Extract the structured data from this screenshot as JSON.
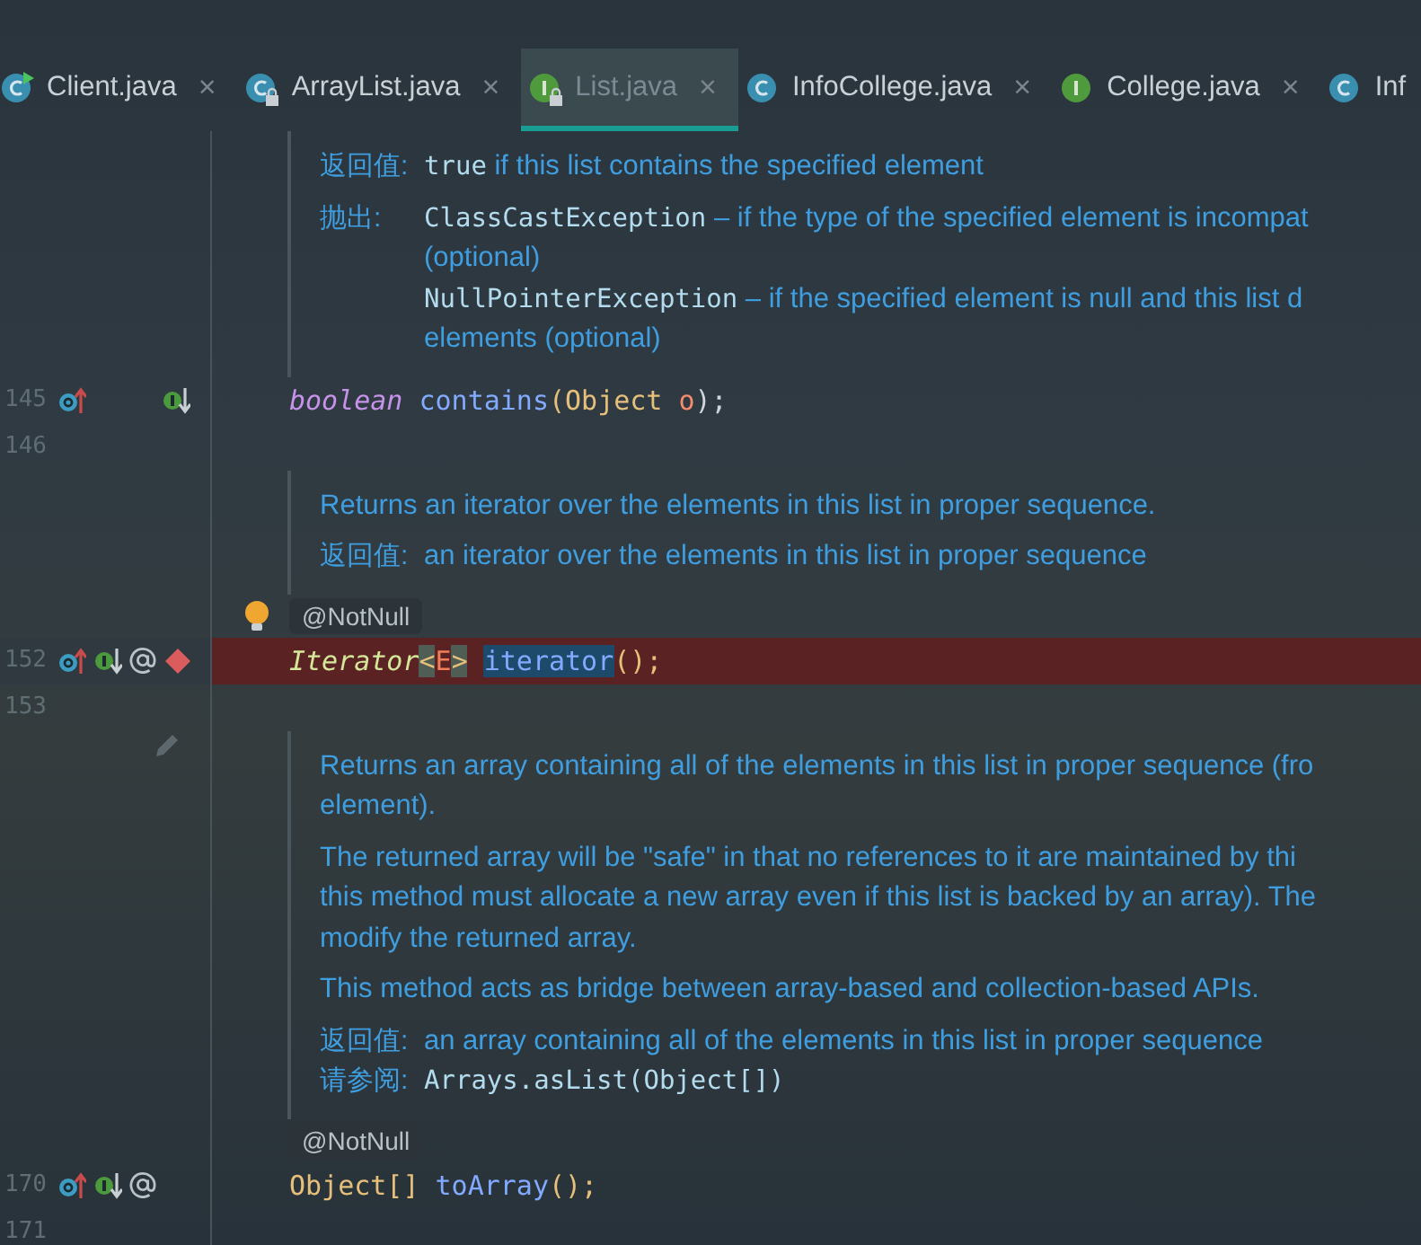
{
  "tabs": [
    {
      "label": "Client.java",
      "kind": "class",
      "runnable": true,
      "locked": false,
      "selected": false,
      "closable": true
    },
    {
      "label": "ArrayList.java",
      "kind": "class",
      "runnable": false,
      "locked": true,
      "selected": false,
      "closable": true
    },
    {
      "label": "List.java",
      "kind": "interface",
      "runnable": false,
      "locked": true,
      "selected": true,
      "closable": true
    },
    {
      "label": "InfoCollege.java",
      "kind": "class",
      "runnable": false,
      "locked": false,
      "selected": false,
      "closable": true
    },
    {
      "label": "College.java",
      "kind": "interface",
      "runnable": false,
      "locked": false,
      "selected": false,
      "closable": true
    },
    {
      "label": "Inf",
      "kind": "class",
      "runnable": false,
      "locked": false,
      "selected": false,
      "closable": false
    }
  ],
  "close_glyph": "×",
  "blocks": [
    {
      "kind": "doc",
      "pencil": false,
      "paragraphs": [
        [
          {
            "label": "返回值:",
            "segments": [
              {
                "text": "true",
                "kind": "code"
              },
              {
                "text": " if this list contains the specified element",
                "kind": "prose"
              }
            ]
          }
        ],
        [
          {
            "label": "抛出:",
            "segments": [
              {
                "text": "ClassCastException",
                "kind": "code"
              },
              {
                "text": " – if the type of the specified element is incompat",
                "kind": "prose"
              }
            ]
          },
          {
            "segments": [
              {
                "text": "(optional)",
                "kind": "prose"
              }
            ]
          },
          {
            "segments": [
              {
                "text": "NullPointerException",
                "kind": "code"
              },
              {
                "text": " – if the specified element is null and this list d",
                "kind": "prose"
              }
            ]
          },
          {
            "segments": [
              {
                "text": "elements (optional)",
                "kind": "prose"
              }
            ]
          }
        ]
      ]
    },
    {
      "kind": "code",
      "number": "145",
      "highlighted": false,
      "markers": [
        {
          "kind": "overrides"
        },
        {
          "kind": "spacer"
        },
        {
          "kind": "implemented"
        }
      ],
      "tokens": [
        {
          "text": "boolean ",
          "kind": "keyword"
        },
        {
          "text": "contains",
          "kind": "method"
        },
        {
          "text": "(",
          "kind": "paren"
        },
        {
          "text": "Object ",
          "kind": "type"
        },
        {
          "text": "o",
          "kind": "param"
        },
        {
          "text": ");",
          "kind": "plain"
        }
      ]
    },
    {
      "kind": "code",
      "number": "146",
      "highlighted": false
    },
    {
      "kind": "doc",
      "pencil": false,
      "paragraphs": [
        [
          {
            "segments": [
              {
                "text": "Returns an iterator over the elements in this list in proper sequence.",
                "kind": "prose"
              }
            ]
          }
        ],
        [
          {
            "label": "返回值:",
            "segments": [
              {
                "text": "an iterator over the elements in this list in proper sequence",
                "kind": "prose"
              }
            ]
          }
        ]
      ]
    },
    {
      "kind": "annotation",
      "text": "@NotNull",
      "bulb": true
    },
    {
      "kind": "code",
      "number": "152",
      "highlighted": true,
      "markers": [
        {
          "kind": "overrides"
        },
        {
          "kind": "implemented"
        },
        {
          "kind": "at"
        },
        {
          "kind": "breakpoint"
        }
      ],
      "tokens": [
        {
          "text": "Iterator",
          "kind": "interface"
        },
        {
          "text": "<",
          "kind": "bracket"
        },
        {
          "text": "E",
          "kind": "typeparam"
        },
        {
          "text": ">",
          "kind": "bracket"
        },
        {
          "text": " iterator",
          "kind": "selected"
        },
        {
          "text": "();",
          "kind": "paren"
        }
      ]
    },
    {
      "kind": "code",
      "number": "153",
      "highlighted": false
    },
    {
      "kind": "doc",
      "pencil": true,
      "paragraphs": [
        [
          {
            "segments": [
              {
                "text": "Returns an array containing all of the elements in this list in proper sequence (fro",
                "kind": "prose"
              }
            ]
          },
          {
            "segments": [
              {
                "text": "element).",
                "kind": "prose"
              }
            ]
          }
        ],
        [
          {
            "segments": [
              {
                "text": "The returned array will be \"safe\" in that no references to it are maintained by thi",
                "kind": "prose"
              }
            ]
          },
          {
            "segments": [
              {
                "text": "this method must allocate a new array even if this list is backed by an array). The",
                "kind": "prose"
              }
            ]
          },
          {
            "segments": [
              {
                "text": "modify the returned array.",
                "kind": "prose"
              }
            ]
          }
        ],
        [
          {
            "segments": [
              {
                "text": "This method acts as bridge between array-based and collection-based APIs.",
                "kind": "prose"
              }
            ]
          }
        ],
        [
          {
            "label": "返回值:",
            "segments": [
              {
                "text": "an array containing all of the elements in this list in proper sequence",
                "kind": "prose"
              }
            ]
          },
          {
            "label": "请参阅:",
            "segments": [
              {
                "text": "Arrays.asList(Object[])",
                "kind": "code"
              }
            ]
          }
        ]
      ]
    },
    {
      "kind": "annotation",
      "text": "@NotNull",
      "bulb": false
    },
    {
      "kind": "code",
      "number": "170",
      "highlighted": false,
      "markers": [
        {
          "kind": "overrides"
        },
        {
          "kind": "implemented"
        },
        {
          "kind": "at"
        }
      ],
      "tokens": [
        {
          "text": "Object[] ",
          "kind": "type"
        },
        {
          "text": "toArray",
          "kind": "method"
        },
        {
          "text": "();",
          "kind": "paren"
        }
      ]
    },
    {
      "kind": "code",
      "number": "171",
      "highlighted": false
    }
  ]
}
